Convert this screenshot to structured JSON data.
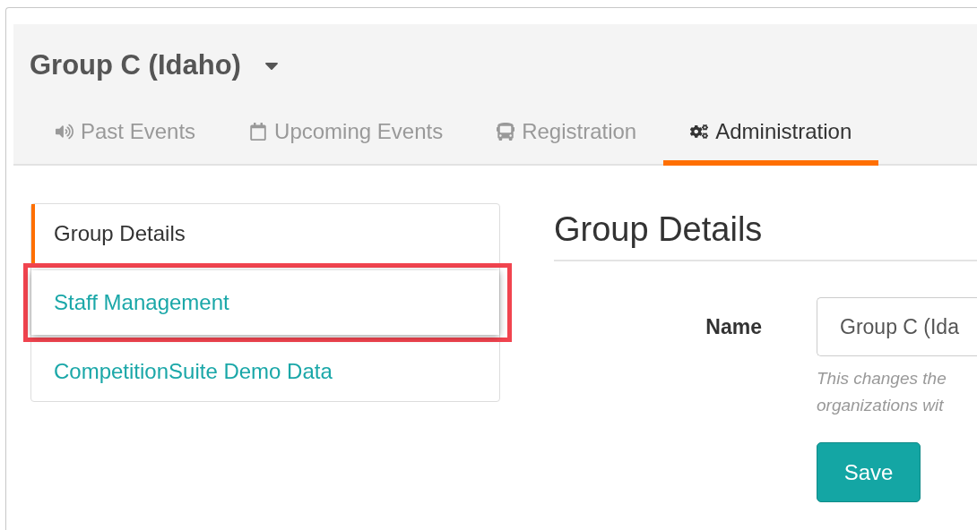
{
  "group_switcher": {
    "title": "Group C (Idaho)"
  },
  "tabs": [
    {
      "label": "Past Events",
      "kind": "speaker",
      "selected": false
    },
    {
      "label": "Upcoming Events",
      "kind": "calendar",
      "selected": false
    },
    {
      "label": "Registration",
      "kind": "bus",
      "selected": false
    },
    {
      "label": "Administration",
      "kind": "cogs",
      "selected": true
    }
  ],
  "sidebar": {
    "items": [
      {
        "label": "Group Details",
        "selected": true,
        "highlighted": false
      },
      {
        "label": "Staff Management",
        "selected": false,
        "highlighted": true
      },
      {
        "label": "CompetitionSuite Demo Data",
        "selected": false,
        "highlighted": false
      }
    ]
  },
  "content": {
    "heading": "Group Details",
    "name_field": {
      "label": "Name",
      "value": "Group C (Ida",
      "help": [
        "This changes the",
        "organizations wit"
      ]
    },
    "save_button": "Save"
  }
}
